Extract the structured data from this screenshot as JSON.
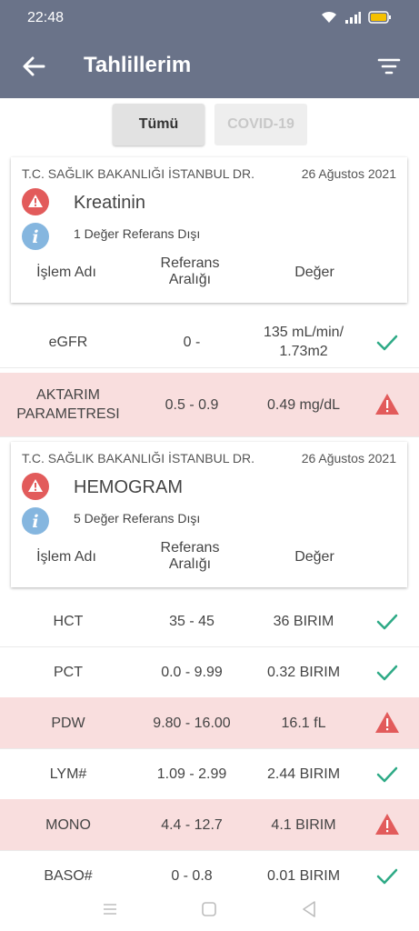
{
  "status_bar": {
    "time": "22:48"
  },
  "app_bar": {
    "title": "Tahlillerim"
  },
  "tabs": [
    {
      "label": "Tümü",
      "active": true
    },
    {
      "label": "COVID-19",
      "active": false
    }
  ],
  "colors": {
    "header": "#6a7389",
    "warning": "#e25b5b",
    "info": "#85b6df",
    "ok": "#2eaa86",
    "out_row": "#f9dede"
  },
  "columns": {
    "name": "İşlem Adı",
    "range_line1": "Referans",
    "range_line2": "Aralığı",
    "value": "Değer"
  },
  "groups": [
    {
      "institution": "T.C. SAĞLIK BAKANLIĞI İSTANBUL DR.",
      "date": "26 Ağustos 2021",
      "test": "Kreatinin",
      "out_of_range": "1 Değer Referans Dışı",
      "rows": [
        {
          "name": "eGFR",
          "range": "0 -",
          "value": "135 mL/min/ 1.73m2",
          "status": "ok"
        },
        {
          "name": "AKTARIM PARAMETRESI",
          "range": "0.5 - 0.9",
          "value": "0.49 mg/dL",
          "status": "warning"
        }
      ]
    },
    {
      "institution": "T.C. SAĞLIK BAKANLIĞI İSTANBUL DR.",
      "date": "26 Ağustos 2021",
      "test": "HEMOGRAM",
      "out_of_range": "5 Değer Referans Dışı",
      "rows": [
        {
          "name": "HCT",
          "range": "35 - 45",
          "value": "36 BIRIM",
          "status": "ok"
        },
        {
          "name": "PCT",
          "range": "0.0 - 9.99",
          "value": "0.32 BIRIM",
          "status": "ok"
        },
        {
          "name": "PDW",
          "range": "9.80 - 16.00",
          "value": "16.1 fL",
          "status": "warning"
        },
        {
          "name": "LYM#",
          "range": "1.09 - 2.99",
          "value": "2.44 BIRIM",
          "status": "ok"
        },
        {
          "name": "MONO",
          "range": "4.4 - 12.7",
          "value": "4.1 BIRIM",
          "status": "warning"
        },
        {
          "name": "BASO#",
          "range": "0 - 0.8",
          "value": "0.01 BIRIM",
          "status": "ok"
        }
      ]
    }
  ]
}
